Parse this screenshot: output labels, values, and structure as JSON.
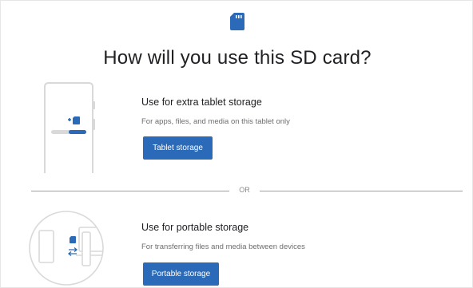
{
  "header": {
    "icon": "sd-card-icon",
    "title": "How will you use this SD card?"
  },
  "option_tablet": {
    "illustration_icon": "tablet-storage-illustration",
    "title": "Use for extra tablet storage",
    "description": "For apps, files, and media on this tablet only",
    "button_label": "Tablet storage"
  },
  "separator": {
    "label": "OR"
  },
  "option_portable": {
    "illustration_icon": "portable-storage-illustration",
    "title": "Use for portable storage",
    "description": "For transferring files and media between devices",
    "button_label": "Portable storage"
  },
  "colors": {
    "accent": "#2a6ab8",
    "text_primary": "#202124",
    "text_secondary": "#6e6e6e",
    "divider": "#9e9e9e"
  }
}
